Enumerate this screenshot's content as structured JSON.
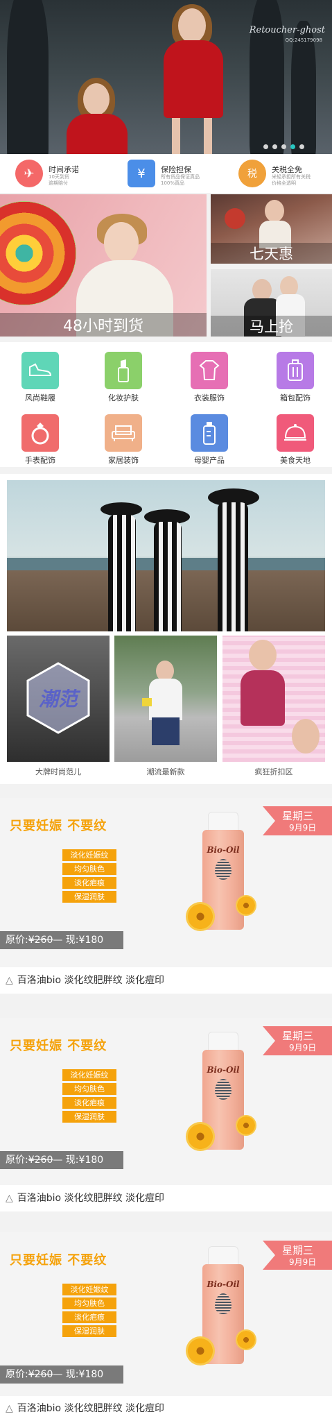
{
  "hero": {
    "watermark": "Retoucher-ghost",
    "watermark_sub": "QQ:245179098",
    "carousel_dots": 5,
    "active_dot": 4
  },
  "promises": [
    {
      "icon": "airplane-icon",
      "color": "#f46868",
      "title": "时间承诺",
      "sub1": "10天到货",
      "sub2": "逾期赔付"
    },
    {
      "icon": "shopping-bag-icon",
      "color": "#4b8ee8",
      "title": "保险担保",
      "sub1": "所有货品保证真品",
      "sub2": "100%真品"
    },
    {
      "icon": "tax-badge-icon",
      "color": "#f0a13a",
      "title": "关税全免",
      "sub1": "米轻承担所有关税",
      "sub2": "价格全透明"
    }
  ],
  "promos": {
    "big_caption": "48小时到货",
    "small1_caption": "七天惠",
    "small2_caption": "马上抢"
  },
  "categories": [
    {
      "label": "风尚鞋履",
      "icon": "shoe-icon",
      "color": "#5fd6b7"
    },
    {
      "label": "化妆护肤",
      "icon": "lipstick-icon",
      "color": "#8bd06a"
    },
    {
      "label": "衣装服饰",
      "icon": "dress-icon",
      "color": "#e66fb4"
    },
    {
      "label": "箱包配饰",
      "icon": "luggage-icon",
      "color": "#b77ae6"
    },
    {
      "label": "手表配饰",
      "icon": "ring-icon",
      "color": "#f06c6c"
    },
    {
      "label": "家居装饰",
      "icon": "sofa-icon",
      "color": "#f0b089"
    },
    {
      "label": "母婴产品",
      "icon": "baby-bottle-icon",
      "color": "#5a8be0"
    },
    {
      "label": "美食天地",
      "icon": "food-cloche-icon",
      "color": "#f05a7a"
    }
  ],
  "fashion": {
    "thumb_text": "潮范",
    "captions": [
      "大牌时尚范儿",
      "潮流最新款",
      "疯狂折扣区"
    ]
  },
  "products": [
    {
      "slogan": "只要妊娠 不要纹",
      "tags": [
        "淡化妊娠纹",
        "均匀肤色",
        "淡化疤痕",
        "保湿润肤"
      ],
      "price_original_label": "原价:",
      "price_original": "¥260",
      "price_now_label": "现:",
      "price_now": "¥180",
      "day": "星期三",
      "date": "9月9日",
      "brand": "Bio-Oil",
      "title": "百洛油bio 淡化纹肥胖纹 淡化痘印"
    },
    {
      "slogan": "只要妊娠 不要纹",
      "tags": [
        "淡化妊娠纹",
        "均匀肤色",
        "淡化疤痕",
        "保湿润肤"
      ],
      "price_original_label": "原价:",
      "price_original": "¥260",
      "price_now_label": "现:",
      "price_now": "¥180",
      "day": "星期三",
      "date": "9月9日",
      "brand": "Bio-Oil",
      "title": "百洛油bio 淡化纹肥胖纹 淡化痘印"
    },
    {
      "slogan": "只要妊娠 不要纹",
      "tags": [
        "淡化妊娠纹",
        "均匀肤色",
        "淡化疤痕",
        "保湿润肤"
      ],
      "price_original_label": "原价:",
      "price_original": "¥260",
      "price_now_label": "现:",
      "price_now": "¥180",
      "day": "星期三",
      "date": "9月9日",
      "brand": "Bio-Oil",
      "title": "百洛油bio 淡化纹肥胖纹 淡化痘印"
    }
  ]
}
